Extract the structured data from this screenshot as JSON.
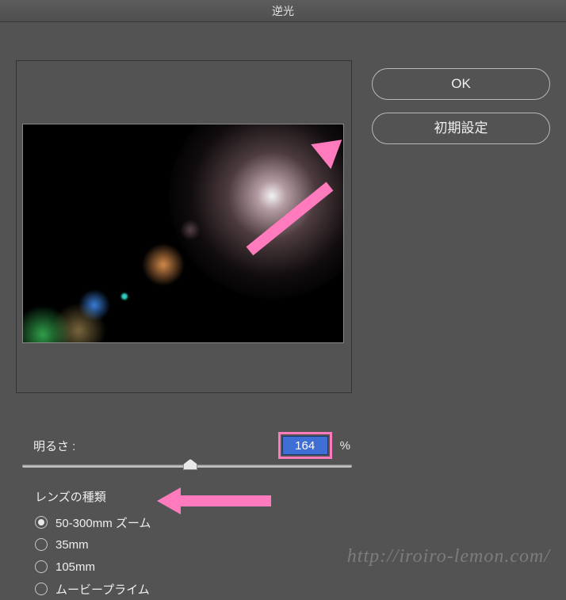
{
  "dialog": {
    "title": "逆光",
    "ok_label": "OK",
    "reset_label": "初期設定"
  },
  "brightness": {
    "label": "明るさ :",
    "value": "164",
    "unit": "%",
    "slider_percent": 51
  },
  "lens": {
    "header": "レンズの種類",
    "options": [
      {
        "label": "50-300mm ズーム",
        "checked": true
      },
      {
        "label": "35mm",
        "checked": false
      },
      {
        "label": "105mm",
        "checked": false
      },
      {
        "label": "ムービープライム",
        "checked": false
      }
    ]
  },
  "watermark": "http://iroiro-lemon.com/",
  "annotations": {
    "highlight_color": "#ff7bbd"
  }
}
